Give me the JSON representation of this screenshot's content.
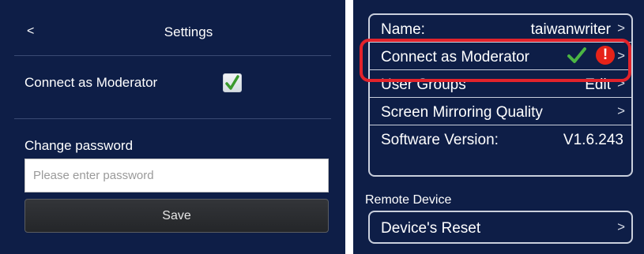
{
  "left": {
    "header": {
      "back": "<",
      "title": "Settings"
    },
    "moderator": {
      "label": "Connect as Moderator",
      "checked": true
    },
    "password": {
      "label": "Change password",
      "placeholder": "Please enter password",
      "save": "Save"
    }
  },
  "right": {
    "settings_group": {
      "rows": [
        {
          "label": "Name:",
          "value": "taiwanwriter",
          "chevron": ">"
        },
        {
          "label": "Connect as Moderator",
          "value": "",
          "chevron": ">",
          "status": [
            "check-icon",
            "alert-icon"
          ],
          "alert_glyph": "!"
        },
        {
          "label": "User Groups",
          "value": "Edit",
          "chevron": ">"
        },
        {
          "label": "Screen Mirroring Quality",
          "value": "",
          "chevron": ">"
        },
        {
          "label": "Software Version:",
          "value": "V1.6.243",
          "chevron": ""
        }
      ]
    },
    "remote_device": {
      "label": "Remote Device",
      "rows": [
        {
          "label": "Device's Reset",
          "chevron": ">"
        }
      ]
    }
  },
  "colors": {
    "panel_bg": "#0e1e47",
    "highlight": "#e3232b",
    "check": "#4bb543",
    "alert": "#e62319"
  }
}
